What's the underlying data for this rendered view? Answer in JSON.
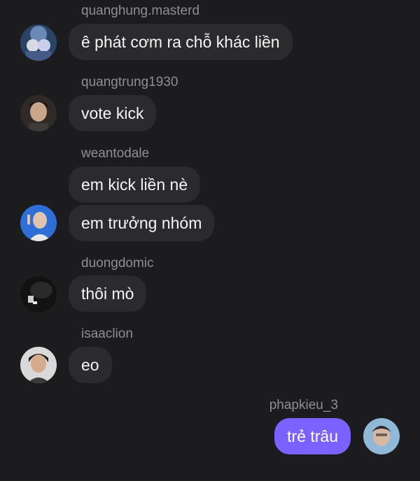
{
  "messages": [
    {
      "username": "quanghung.masterd",
      "text": "ê phát cơm ra chỗ khác liền",
      "avatar": "avatar-concert-crowd"
    },
    {
      "username": "quangtrung1930",
      "text": "vote kick",
      "avatar": "avatar-man-face"
    },
    {
      "username": "weantodale",
      "text": "em kick liền nè",
      "avatar": null
    },
    {
      "username": null,
      "text": "em trưởng nhóm",
      "avatar": "avatar-man-blue-background"
    },
    {
      "username": "duongdomic",
      "text": "thôi mò",
      "avatar": "avatar-dark-stage"
    },
    {
      "username": "isaaclion",
      "text": "eo",
      "avatar": "avatar-woman"
    },
    {
      "username": "phapkieu_3",
      "text": "trẻ trâu",
      "avatar": "avatar-own-profile",
      "outgoing": true
    }
  ],
  "colors": {
    "background": "#1c1c1e",
    "incoming_bubble": "#2b2b2d",
    "outgoing_bubble": "#7b61ff",
    "username": "#8e8e93"
  }
}
